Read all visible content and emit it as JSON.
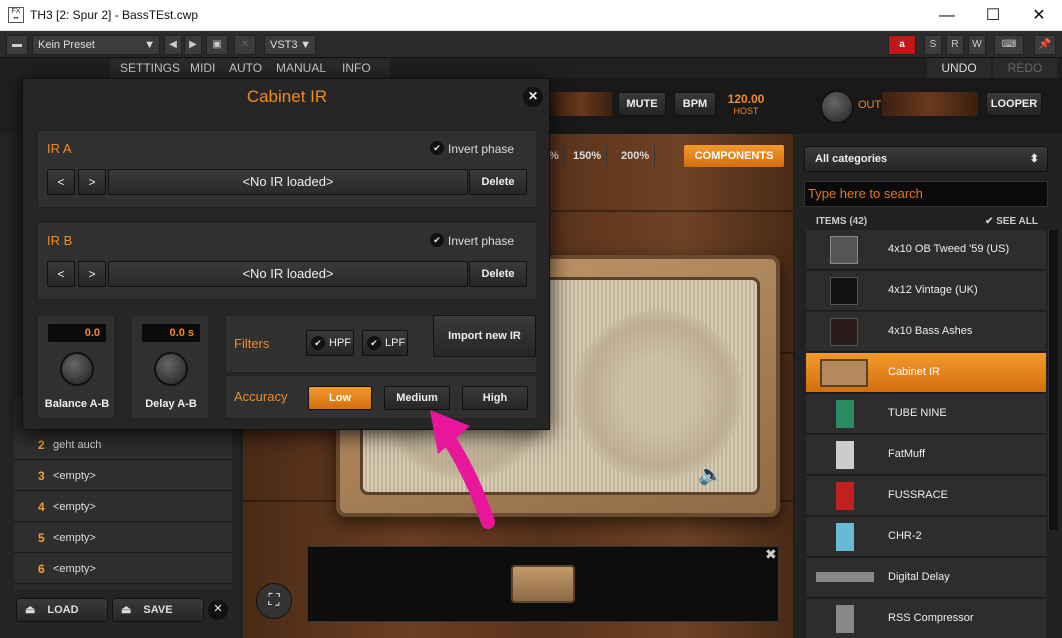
{
  "window": {
    "title": "TH3 [2: Spur 2] - BassTEst.cwp",
    "minimize": "—",
    "maximize": "☐",
    "close": "✕"
  },
  "hostbar": {
    "preset": "Kein Preset",
    "plugin_format": "VST3",
    "s": "S",
    "r": "R",
    "w": "W"
  },
  "menu": {
    "settings": "SETTINGS",
    "midi": "MIDI",
    "auto": "AUTO",
    "manual": "MANUAL",
    "info": "INFO",
    "undo": "UNDO",
    "redo": "REDO"
  },
  "topbar": {
    "mute": "MUTE",
    "bpm": "BPM",
    "bpm_value": "120.00",
    "bpm_source": "HOST",
    "out": "OUT",
    "looper": "LOOPER"
  },
  "zoom": {
    "pct": "%",
    "z150": "150%",
    "z200": "200%",
    "components": "COMPONENTS"
  },
  "browser": {
    "category": "All categories",
    "search_placeholder": "Type here to search",
    "items_count": "ITEMS (42)",
    "see_all": "SEE ALL",
    "items": [
      {
        "label": "4x10 OB Tweed '59 (US)",
        "selected": false
      },
      {
        "label": "4x12 Vintage (UK)",
        "selected": false
      },
      {
        "label": "4x10 Bass Ashes",
        "selected": false
      },
      {
        "label": "Cabinet IR",
        "selected": true
      },
      {
        "label": "TUBE NINE",
        "selected": false
      },
      {
        "label": "FatMuff",
        "selected": false
      },
      {
        "label": "FUSSRACE",
        "selected": false
      },
      {
        "label": "CHR-2",
        "selected": false
      },
      {
        "label": "Digital Delay",
        "selected": false
      },
      {
        "label": "RSS Compressor",
        "selected": false
      }
    ]
  },
  "presets": {
    "rows": [
      {
        "num": "2",
        "name": "geht auch"
      },
      {
        "num": "3",
        "name": "<empty>"
      },
      {
        "num": "4",
        "name": "<empty>"
      },
      {
        "num": "5",
        "name": "<empty>"
      },
      {
        "num": "6",
        "name": "<empty>"
      }
    ],
    "load": "LOAD",
    "save": "SAVE"
  },
  "modal": {
    "title": "Cabinet IR",
    "ir_a": {
      "label": "IR A",
      "invert": "Invert phase",
      "name": "<No IR loaded>",
      "delete": "Delete"
    },
    "ir_b": {
      "label": "IR B",
      "invert": "Invert phase",
      "name": "<No IR loaded>",
      "delete": "Delete"
    },
    "balance": {
      "value": "0.0",
      "label": "Balance A-B"
    },
    "delay": {
      "value": "0.0 s",
      "label": "Delay A-B"
    },
    "filters": {
      "label": "Filters",
      "hpf": "HPF",
      "lpf": "LPF"
    },
    "import": "Import new IR",
    "accuracy": {
      "label": "Accuracy",
      "low": "Low",
      "medium": "Medium",
      "high": "High",
      "selected": "Low"
    }
  },
  "colors": {
    "accent": "#f08a24",
    "annotation": "#e8169a"
  }
}
